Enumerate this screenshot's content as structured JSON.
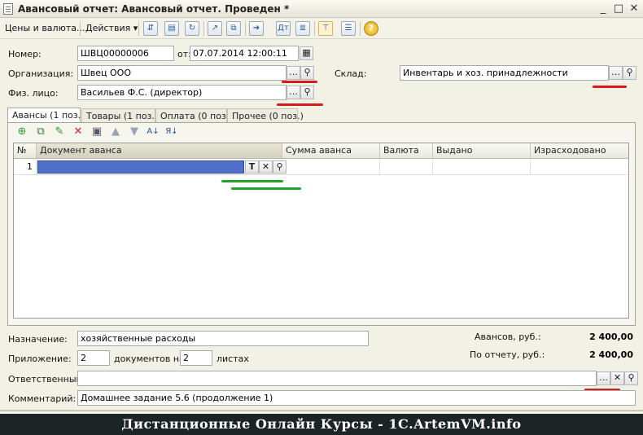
{
  "window": {
    "title": "Авансовый отчет: Авансовый отчет. Проведен *",
    "min": "_",
    "max": "□",
    "close": "✕"
  },
  "toolbar": {
    "prices": "Цены и валюта...",
    "actions": "Действия ▾"
  },
  "form": {
    "number_label": "Номер:",
    "number_value": "ШВЦ00000006",
    "date_label": "от:",
    "date_value": "07.07.2014 12:00:11",
    "org_label": "Организация:",
    "org_value": "Швец ООО",
    "warehouse_label": "Склад:",
    "warehouse_value": "Инвентарь и хоз. принадлежности",
    "person_label": "Физ. лицо:",
    "person_value": "Васильев Ф.С. (директор)"
  },
  "tabs": [
    "Авансы (1 поз.)",
    "Товары (1 поз.)",
    "Оплата (0 поз.)",
    "Прочее (0 поз.)"
  ],
  "table": {
    "headers": [
      "№",
      "Документ аванса",
      "Сумма аванса",
      "Валюта",
      "Выдано",
      "Израсходовано"
    ],
    "rows": [
      {
        "n": "1",
        "doc": ""
      }
    ],
    "cell_btn_t": "T",
    "cell_btn_x": "✕"
  },
  "bottom": {
    "purpose_label": "Назначение:",
    "purpose_value": "хозяйственные расходы",
    "attach_label": "Приложение:",
    "attach_docs": "2",
    "docs_on": "документов на",
    "attach_sheets": "2",
    "sheets": "листах",
    "advances_label": "Авансов, руб.:",
    "advances_value": "2 400,00",
    "report_label": "По отчету, руб.:",
    "report_value": "2 400,00",
    "resp_label": "Ответственный:",
    "resp_value": "",
    "comment_label": "Комментарий:",
    "comment_value": "Домашнее задание 5.6 (продолжение 1)"
  },
  "banner": "Дистанционные Онлайн Курсы - 1С.ArtemVM.info",
  "colors": {
    "red_mark": "#d71b1b",
    "green_mark": "#21a32c",
    "selection": "#4f6fc8"
  }
}
